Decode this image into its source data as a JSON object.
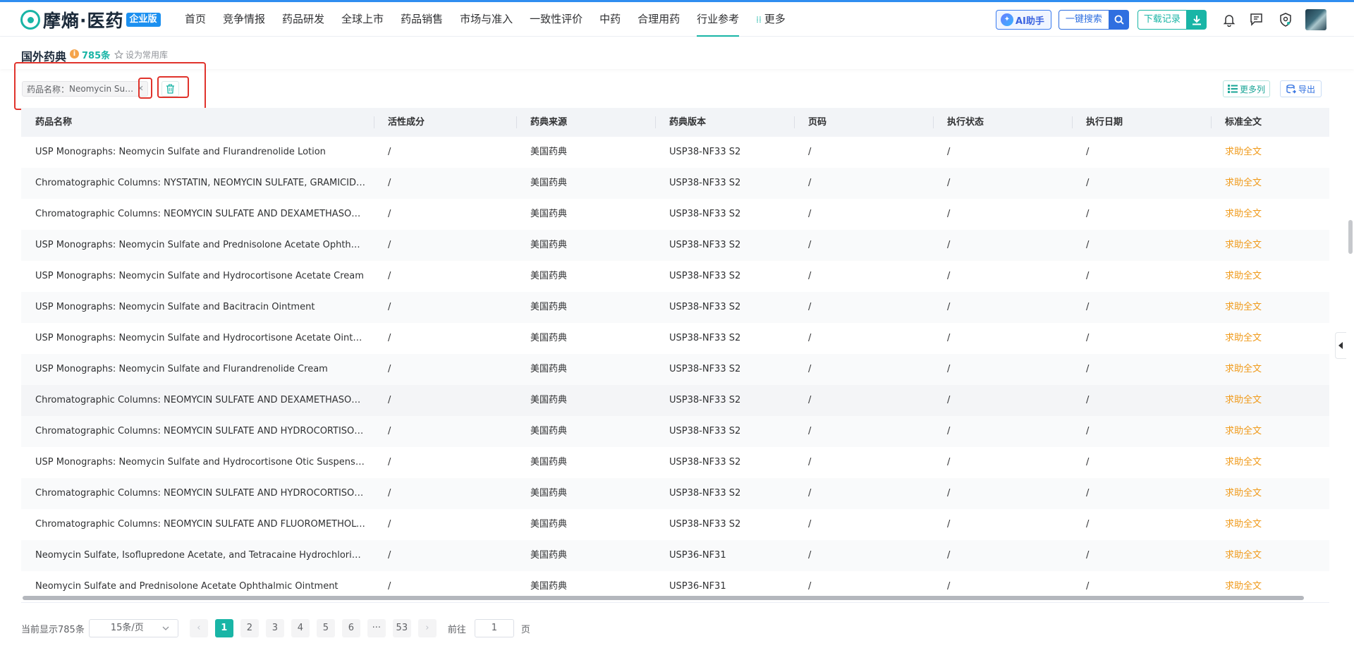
{
  "brand": {
    "name": "摩熵·医药",
    "badge": "企业版"
  },
  "nav": {
    "items": [
      {
        "label": "首页",
        "active": false
      },
      {
        "label": "竞争情报",
        "active": false
      },
      {
        "label": "药品研发",
        "active": false
      },
      {
        "label": "全球上市",
        "active": false
      },
      {
        "label": "药品销售",
        "active": false
      },
      {
        "label": "市场与准入",
        "active": false
      },
      {
        "label": "一致性评价",
        "active": false
      },
      {
        "label": "中药",
        "active": false
      },
      {
        "label": "合理用药",
        "active": false
      },
      {
        "label": "行业参考",
        "active": true
      }
    ],
    "more_label": "更多"
  },
  "header_actions": {
    "ai_label": "AI助手",
    "search_label": "一键搜索",
    "download_label": "下载记录",
    "icons": [
      "bell-icon",
      "message-icon",
      "shield-icon"
    ]
  },
  "page": {
    "title": "国外药典",
    "count": "785条",
    "favorite_label": "设为常用库"
  },
  "filter": {
    "label": "药品名称：",
    "value": "Neomycin Su…"
  },
  "toolbar": {
    "more_columns_label": "更多列",
    "export_label": "导出"
  },
  "table": {
    "columns": [
      "药品名称",
      "活性成分",
      "药典来源",
      "药典版本",
      "页码",
      "执行状态",
      "执行日期",
      "标准全文"
    ],
    "rows": [
      [
        "USP Monographs: Neomycin Sulfate and Flurandrenolide Lotion",
        "/",
        "美国药典",
        "USP38-NF33 S2",
        "/",
        "/",
        "/",
        "求助全文"
      ],
      [
        "Chromatographic Columns: NYSTATIN, NEOMYCIN SULFATE, GRAMICIDIN, A…",
        "/",
        "美国药典",
        "USP38-NF33 S2",
        "/",
        "/",
        "/",
        "求助全文"
      ],
      [
        "Chromatographic Columns: NEOMYCIN SULFATE AND DEXAMETHASONE SO…",
        "/",
        "美国药典",
        "USP38-NF33 S2",
        "/",
        "/",
        "/",
        "求助全文"
      ],
      [
        "USP Monographs: Neomycin Sulfate and Prednisolone Acetate Ophthalmic …",
        "/",
        "美国药典",
        "USP38-NF33 S2",
        "/",
        "/",
        "/",
        "求助全文"
      ],
      [
        "USP Monographs: Neomycin Sulfate and Hydrocortisone Acetate Cream",
        "/",
        "美国药典",
        "USP38-NF33 S2",
        "/",
        "/",
        "/",
        "求助全文"
      ],
      [
        "USP Monographs: Neomycin Sulfate and Bacitracin Ointment",
        "/",
        "美国药典",
        "USP38-NF33 S2",
        "/",
        "/",
        "/",
        "求助全文"
      ],
      [
        "USP Monographs: Neomycin Sulfate and Hydrocortisone Acetate Ointment",
        "/",
        "美国药典",
        "USP38-NF33 S2",
        "/",
        "/",
        "/",
        "求助全文"
      ],
      [
        "USP Monographs: Neomycin Sulfate and Flurandrenolide Cream",
        "/",
        "美国药典",
        "USP38-NF33 S2",
        "/",
        "/",
        "/",
        "求助全文"
      ],
      [
        "Chromatographic Columns: NEOMYCIN SULFATE AND DEXAMETHASONE SO…",
        "/",
        "美国药典",
        "USP38-NF33 S2",
        "/",
        "/",
        "/",
        "求助全文"
      ],
      [
        "Chromatographic Columns: NEOMYCIN SULFATE AND HYDROCORTISONE A…",
        "/",
        "美国药典",
        "USP38-NF33 S2",
        "/",
        "/",
        "/",
        "求助全文"
      ],
      [
        "USP Monographs: Neomycin Sulfate and Hydrocortisone Otic Suspension",
        "/",
        "美国药典",
        "USP38-NF33 S2",
        "/",
        "/",
        "/",
        "求助全文"
      ],
      [
        "Chromatographic Columns: NEOMYCIN SULFATE AND HYDROCORTISONE A…",
        "/",
        "美国药典",
        "USP38-NF33 S2",
        "/",
        "/",
        "/",
        "求助全文"
      ],
      [
        "Chromatographic Columns: NEOMYCIN SULFATE AND FLUOROMETHOLONE…",
        "/",
        "美国药典",
        "USP38-NF33 S2",
        "/",
        "/",
        "/",
        "求助全文"
      ],
      [
        "Neomycin Sulfate, Isoflupredone Acetate, and Tetracaine Hydrochloride Oi…",
        "/",
        "美国药典",
        "USP36-NF31",
        "/",
        "/",
        "/",
        "求助全文"
      ],
      [
        "Neomycin Sulfate and Prednisolone Acetate Ophthalmic Ointment",
        "/",
        "美国药典",
        "USP36-NF31",
        "/",
        "/",
        "/",
        "求助全文"
      ]
    ]
  },
  "pagination": {
    "total_text": "当前显示785条",
    "page_size": "15条/页",
    "prev": "‹",
    "pages": [
      "1",
      "2",
      "3",
      "4",
      "5",
      "6"
    ],
    "ellipsis": "···",
    "last_page": "53",
    "next": "›",
    "goto_label": "前往",
    "goto_value": "1",
    "goto_unit": "页"
  },
  "colors": {
    "brand": "#19b5a6",
    "link": "#f09a1a",
    "highlight": "#e0332c"
  }
}
